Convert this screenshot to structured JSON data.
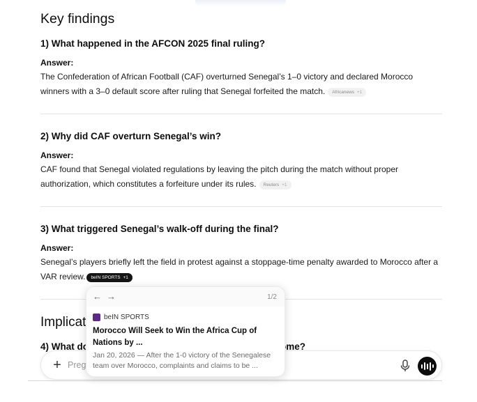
{
  "heading": "Key findings",
  "items": [
    {
      "question": "1) What happened in the AFCON 2025 final ruling?",
      "answer_label": "Answer:",
      "answer": "The Confederation of African Football (CAF) overturned Senegal’s 1–0 victory and declared Morocco winners with a 3–0 default score after ruling that Senegal forfeited the match.",
      "source": "Africanews",
      "source_more": "+1"
    },
    {
      "question": "2) Why did CAF overturn Senegal’s win?",
      "answer_label": "Answer:",
      "answer": "CAF found that Senegal violated regulations by leaving the pitch during the match without proper authorization, which constitutes a forfeiture under its rules.",
      "source": "Reuters",
      "source_more": "+1"
    },
    {
      "question": "3) What triggered Senegal’s walk-off during the final?",
      "answer_label": "Answer:",
      "answer": "Senegal’s players briefly left the field in protest against a stoppage-time penalty awarded to Morocco after a VAR review.",
      "source": "beIN SPORTS",
      "source_more": "+1"
    }
  ],
  "section2": {
    "heading_visible": "Implicat",
    "q4_start": "4) What do",
    "q4_end": "ome?"
  },
  "popup": {
    "prev_icon": "←",
    "next_icon": "→",
    "pager": "1/2",
    "source_name": "beIN SPORTS",
    "title": "Morocco Will Seek to Win the Africa Cup of Nations by ...",
    "snippet": "Jan 20, 2026 — After the 1-0 victory of the Senegalese team over Morocco, complaints and claims to be ..."
  },
  "composer": {
    "plus_icon": "+",
    "placeholder_visible": "Preg"
  },
  "colors": {
    "text": "#0d0d0d",
    "chip_bg": "#f1f1f1",
    "chip_active_bg": "#151515",
    "favicon": "#5b2a86"
  }
}
